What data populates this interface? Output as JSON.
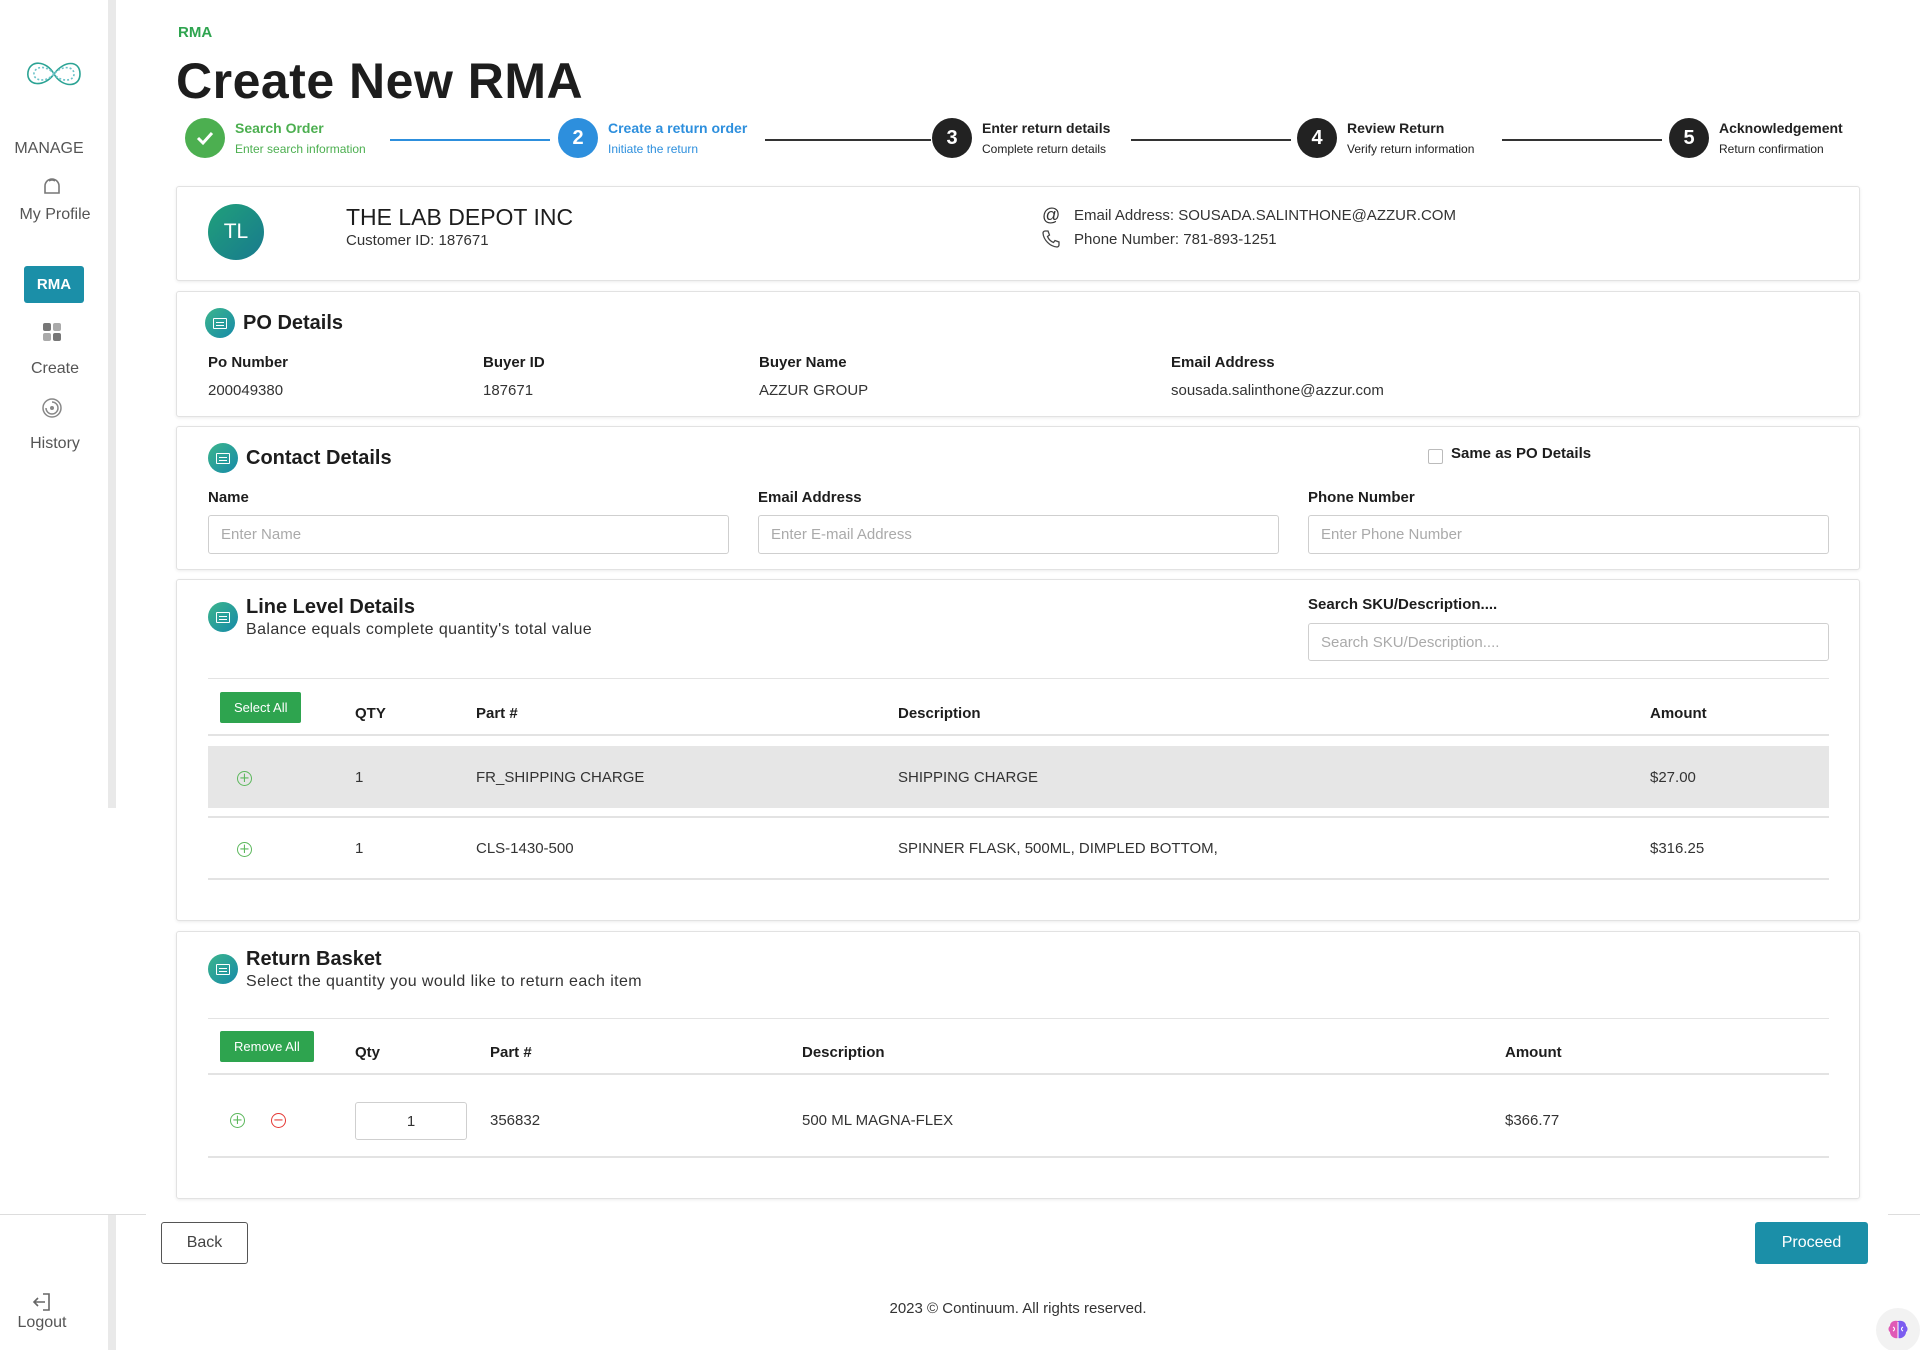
{
  "sidebar": {
    "manage_label": "MANAGE",
    "my_profile_label": "My Profile",
    "rma_label": "RMA",
    "create_label": "Create",
    "history_label": "History",
    "logout_label": "Logout"
  },
  "breadcrumb": "RMA",
  "page_title": "Create New RMA",
  "steps": [
    {
      "number": "",
      "title": "Search Order",
      "subtitle": "Enter search information",
      "state": "complete",
      "color": "#4caf50"
    },
    {
      "number": "2",
      "title": "Create a return order",
      "subtitle": "Initiate the return",
      "state": "active",
      "color": "#2d8fdd"
    },
    {
      "number": "3",
      "title": "Enter return details",
      "subtitle": "Complete return details",
      "state": "pending",
      "color": "#222222"
    },
    {
      "number": "4",
      "title": "Review Return",
      "subtitle": "Verify return information",
      "state": "pending",
      "color": "#222222"
    },
    {
      "number": "5",
      "title": "Acknowledgement",
      "subtitle": "Return confirmation",
      "state": "pending",
      "color": "#222222"
    }
  ],
  "customer": {
    "initials": "TL",
    "name": "THE LAB DEPOT INC",
    "customer_id": "Customer ID: 187671",
    "email": "Email Address: SOUSADA.SALINTHONE@AZZUR.COM",
    "phone": "Phone Number: 781-893-1251"
  },
  "po_details": {
    "title": "PO Details",
    "po_number_label": "Po Number",
    "po_number": "200049380",
    "buyer_id_label": "Buyer ID",
    "buyer_id": "187671",
    "buyer_name_label": "Buyer Name",
    "buyer_name": "AZZUR GROUP",
    "email_label": "Email Address",
    "email": "sousada.salinthone@azzur.com"
  },
  "contact_details": {
    "title": "Contact Details",
    "same_as_po_label": "Same as PO Details",
    "same_as_po_checked": false,
    "name_label": "Name",
    "name_value": "",
    "name_placeholder": "Enter Name",
    "email_label": "Email Address",
    "email_value": "",
    "email_placeholder": "Enter E-mail Address",
    "phone_label": "Phone Number",
    "phone_value": "",
    "phone_placeholder": "Enter Phone Number"
  },
  "line_level": {
    "title": "Line Level Details",
    "subtitle": "Balance equals complete quantity's total value",
    "search_label": "Search SKU/Description....",
    "search_placeholder": "Search SKU/Description....",
    "select_all_label": "Select All",
    "columns": {
      "qty": "QTY",
      "part": "Part #",
      "description": "Description",
      "amount": "Amount"
    },
    "rows": [
      {
        "qty": "1",
        "part": "FR_SHIPPING CHARGE",
        "description": "SHIPPING CHARGE",
        "amount": "$27.00",
        "highlighted": true
      },
      {
        "qty": "1",
        "part": "CLS-1430-500",
        "description": "SPINNER FLASK, 500ML, DIMPLED BOTTOM,",
        "amount": "$316.25",
        "highlighted": false
      }
    ]
  },
  "return_basket": {
    "title": "Return Basket",
    "subtitle": "Select the quantity you would like to return each item",
    "remove_all_label": "Remove All",
    "columns": {
      "qty": "Qty",
      "part": "Part #",
      "description": "Description",
      "amount": "Amount"
    },
    "rows": [
      {
        "qty": "1",
        "part": "356832",
        "description": "500 ML MAGNA-FLEX",
        "amount": "$366.77"
      }
    ]
  },
  "actions": {
    "back_label": "Back",
    "proceed_label": "Proceed"
  },
  "footer": "2023 © Continuum. All rights reserved.",
  "colors": {
    "accent_teal": "#1b8fa8",
    "accent_green": "#2ea44f",
    "step_active_blue": "#2d8fdd",
    "remove_red": "#e53935"
  }
}
